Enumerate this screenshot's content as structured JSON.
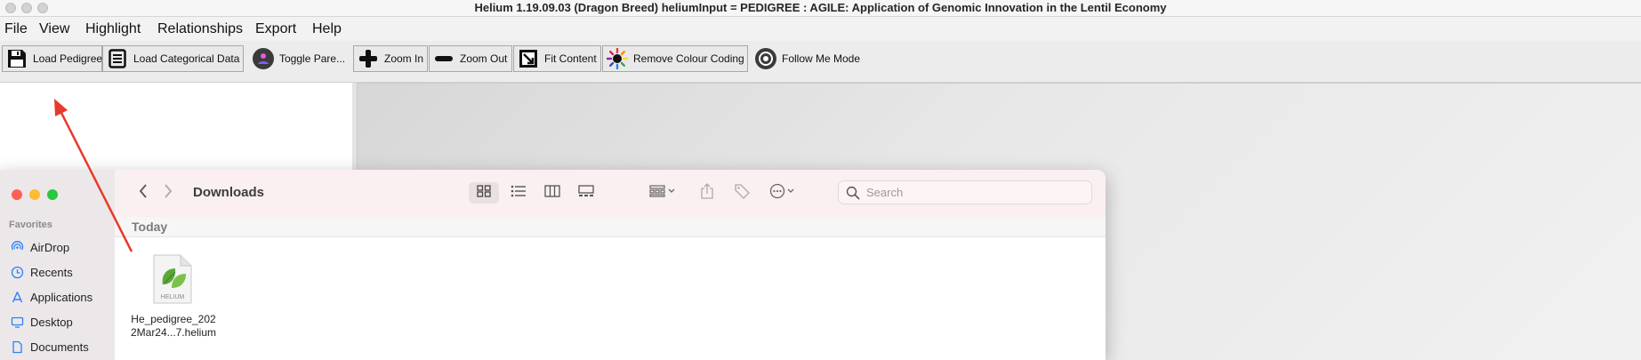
{
  "window": {
    "title": "Helium 1.19.09.03 (Dragon Breed)  heliumInput = PEDIGREE : AGILE: Application of Genomic Innovation in the Lentil Economy"
  },
  "menu": [
    "File",
    "View",
    "Highlight",
    "Relationships",
    "Export",
    "Help"
  ],
  "toolbar": [
    {
      "label": "Load Pedigree",
      "icon": "floppy-disk-icon"
    },
    {
      "label": "Load Categorical Data",
      "icon": "document-icon"
    },
    {
      "label": "Toggle Pare...",
      "icon": "parents-icon"
    },
    {
      "label": "Zoom In",
      "icon": "plus-icon"
    },
    {
      "label": "Zoom Out",
      "icon": "minus-icon"
    },
    {
      "label": "Fit Content",
      "icon": "fit-content-icon"
    },
    {
      "label": "Remove Colour Coding",
      "icon": "colour-wheel-icon"
    },
    {
      "label": "Follow Me Mode",
      "icon": "target-icon"
    }
  ],
  "finder": {
    "location": "Downloads",
    "search_placeholder": "Search",
    "favorites_header": "Favorites",
    "favorites": [
      {
        "label": "AirDrop",
        "icon": "airdrop-icon"
      },
      {
        "label": "Recents",
        "icon": "clock-icon"
      },
      {
        "label": "Applications",
        "icon": "applications-icon"
      },
      {
        "label": "Desktop",
        "icon": "desktop-icon"
      },
      {
        "label": "Documents",
        "icon": "document-icon"
      }
    ],
    "section": "Today",
    "files": [
      {
        "name_line1": "He_pedigree_202",
        "name_line2": "2Mar24...7.helium",
        "icon_label": "HELIUM"
      }
    ]
  },
  "colors": {
    "close": "#ff5f57",
    "minimize": "#febc2e",
    "zoom": "#28c840",
    "annotation_arrow": "#e8392a",
    "sidebar_icon": "#2d7ff9"
  }
}
